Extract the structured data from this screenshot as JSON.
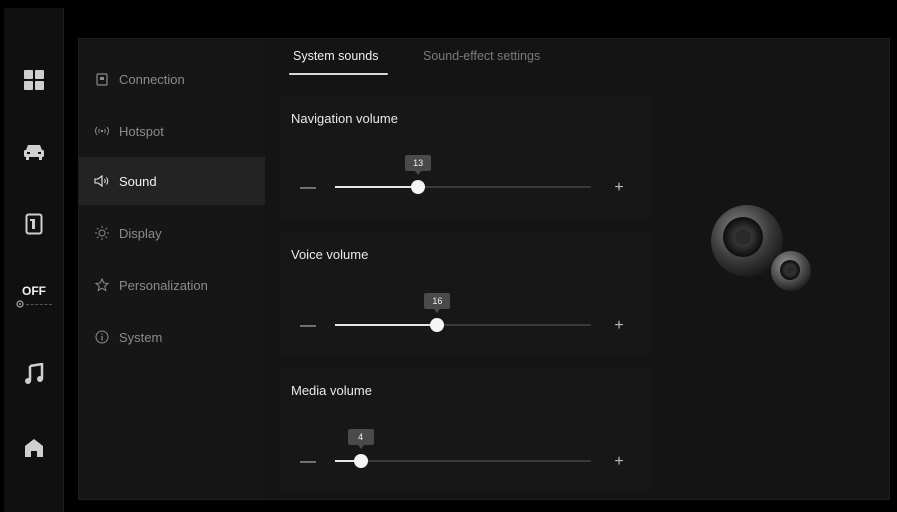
{
  "rail": {
    "items": [
      {
        "name": "apps",
        "icon": "grid-icon"
      },
      {
        "name": "vehicle",
        "icon": "car-icon"
      },
      {
        "name": "device",
        "icon": "phone-card-icon"
      },
      {
        "name": "ac",
        "icon": "fan-icon",
        "label": "OFF"
      },
      {
        "name": "music",
        "icon": "music-note-icon"
      },
      {
        "name": "home",
        "icon": "home-icon"
      }
    ]
  },
  "subnav": {
    "items": [
      {
        "label": "Connection",
        "icon": "connection-icon",
        "active": false
      },
      {
        "label": "Hotspot",
        "icon": "hotspot-icon",
        "active": false
      },
      {
        "label": "Sound",
        "icon": "speaker-icon",
        "active": true
      },
      {
        "label": "Display",
        "icon": "brightness-icon",
        "active": false
      },
      {
        "label": "Personalization",
        "icon": "personalization-icon",
        "active": false
      },
      {
        "label": "System",
        "icon": "info-icon",
        "active": false
      }
    ]
  },
  "tabs": [
    {
      "label": "System sounds",
      "active": true
    },
    {
      "label": "Sound-effect settings",
      "active": false
    }
  ],
  "volumes": [
    {
      "title": "Navigation volume",
      "value": 13,
      "max": 40,
      "minus": "—",
      "plus": "+"
    },
    {
      "title": "Voice volume",
      "value": 16,
      "max": 40,
      "minus": "—",
      "plus": "+"
    },
    {
      "title": "Media volume",
      "value": 4,
      "max": 40,
      "minus": "—",
      "plus": "+"
    }
  ],
  "colors": {
    "background": "#000000",
    "panel": "#141414",
    "accent": "#e6e6e6"
  }
}
